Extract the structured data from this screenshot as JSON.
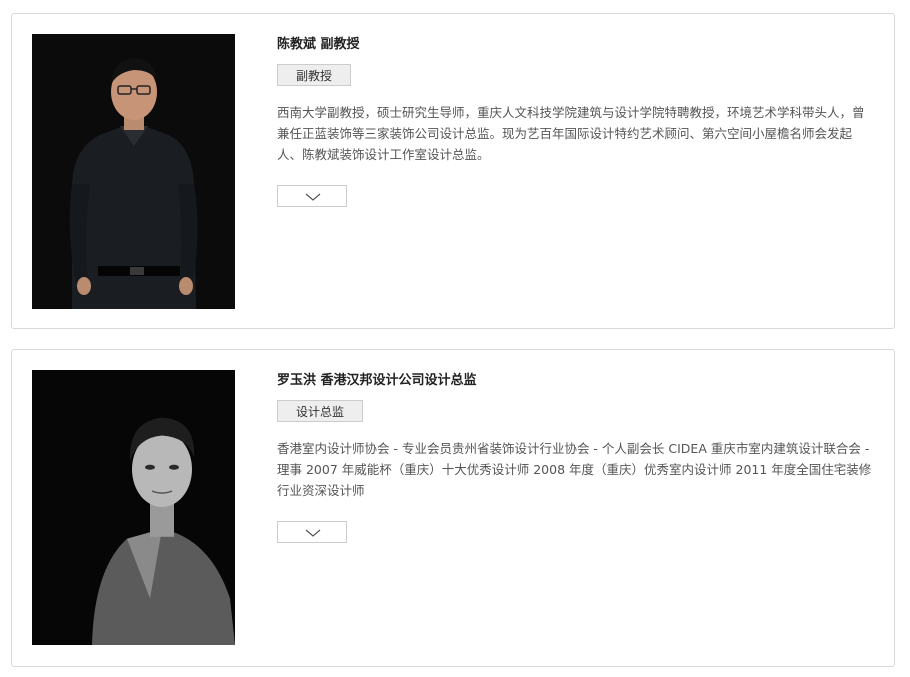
{
  "people": [
    {
      "name": "陈教斌 副教授",
      "tag": "副教授",
      "bio": "西南大学副教授，硕士研究生导师，重庆人文科技学院建筑与设计学院特聘教授，环境艺术学科带头人，曾兼任正蓝装饰等三家装饰公司设计总监。现为艺百年国际设计特约艺术顾问、第六空间小屋檐名师会发起人、陈教斌装饰设计工作室设计总监。",
      "expand_icon": "chevron-down-icon"
    },
    {
      "name": "罗玉洪 香港汉邦设计公司设计总监",
      "tag": "设计总监",
      "bio": "香港室内设计师协会 - 专业会员贵州省装饰设计行业协会 - 个人副会长 CIDEA 重庆市室内建筑设计联合会 - 理事 2007 年威能杯（重庆）十大优秀设计师 2008 年度（重庆）优秀室内设计师 2011 年度全国住宅装修行业资深设计师",
      "expand_icon": "chevron-down-icon"
    }
  ]
}
